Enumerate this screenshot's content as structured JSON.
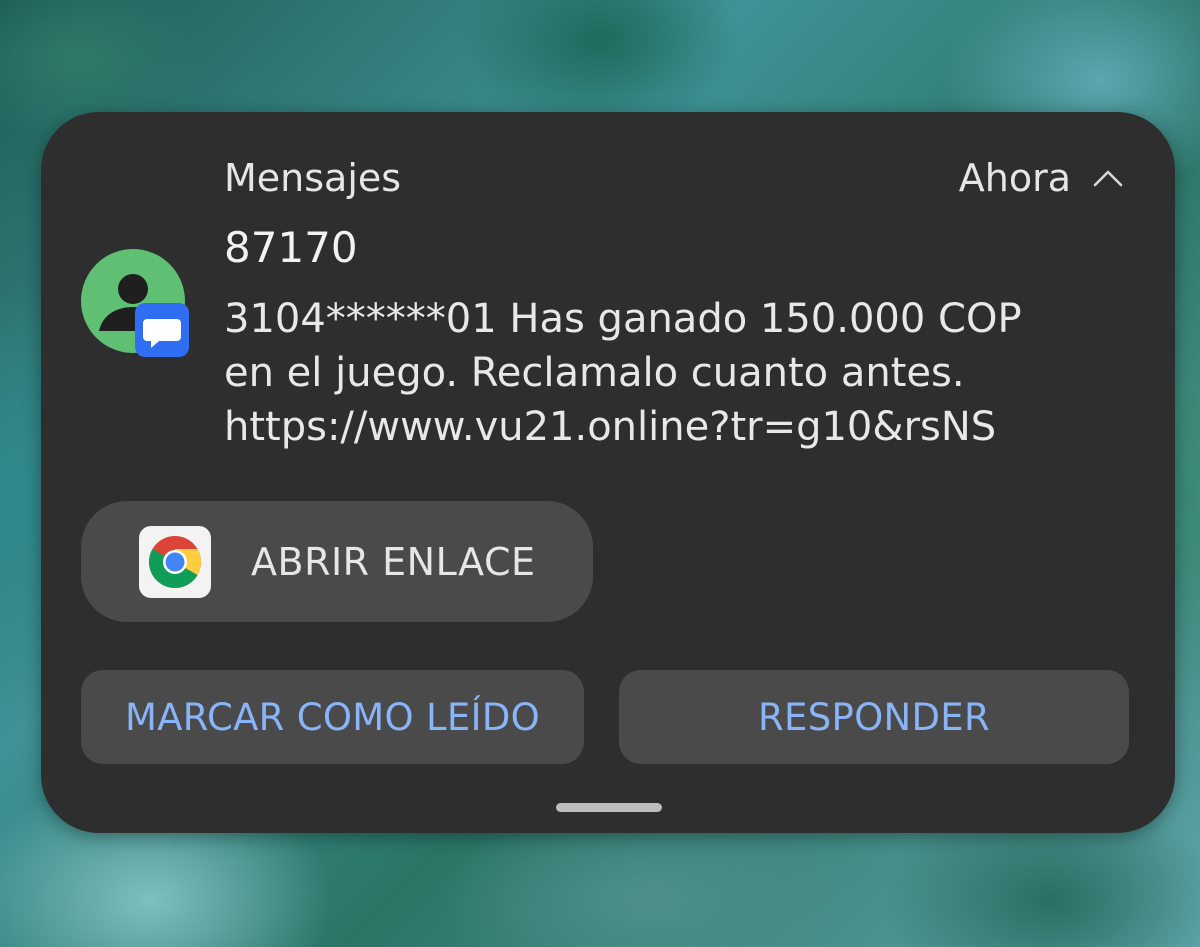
{
  "notification": {
    "app_name": "Mensajes",
    "time": "Ahora",
    "collapse_icon": "chevron-up-icon",
    "avatar_icon": "contact-person-icon",
    "badge_icon": "messages-app-icon",
    "sender": "87170",
    "message_lines": [
      "3104******01 Has ganado 150.000 COP",
      "en el juego. Reclamalo cuanto antes.",
      "https://www.vu21.online?tr=g10&rsNS"
    ],
    "open_link": {
      "icon": "chrome-icon",
      "label": "ABRIR ENLACE"
    },
    "actions": {
      "mark_read": "MARCAR COMO LEÍDO",
      "reply": "RESPONDER"
    }
  },
  "colors": {
    "card_background": "#2e2e2e",
    "button_background": "#4a4a4a",
    "action_text": "#8ab4f8",
    "avatar_green": "#5fbf72",
    "badge_blue": "#2f6ef3"
  }
}
